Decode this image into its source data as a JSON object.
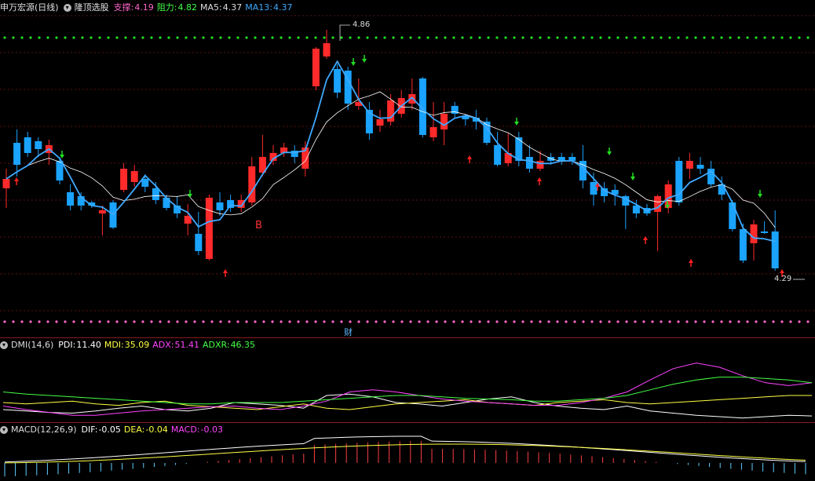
{
  "header": {
    "stock_name": "申万宏源(日线)",
    "indicator_name": "隆顶选股",
    "support_label": "支撑:",
    "support_value": "4.19",
    "resist_label": "阻力:",
    "resist_value": "4.82",
    "ma5_label": "MA5:",
    "ma5_value": "4.37",
    "ma13_label": "MA13:",
    "ma13_value": "4.37"
  },
  "main_chart": {
    "high_label": "4.86",
    "low_label": "4.29",
    "buy_marker": "B",
    "finance_label": "财",
    "colors": {
      "up": "#ff2a2a",
      "down": "#1aa3ff",
      "ma5": "#3fa9ff",
      "ma13": "#ffffff",
      "resist_dots": "#22dd22",
      "support_dots": "#ff66cc",
      "grid": "#5a1010"
    }
  },
  "dmi": {
    "title": "DMI(14,6)",
    "pdi_label": "PDI:",
    "pdi_value": "11.40",
    "mdi_label": "MDI:",
    "mdi_value": "35.09",
    "adx_label": "ADX:",
    "adx_value": "51.41",
    "adxr_label": "ADXR:",
    "adxr_value": "46.35",
    "colors": {
      "pdi": "#ffffff",
      "mdi": "#ffff44",
      "adx": "#ff44ff",
      "adxr": "#44ff44"
    }
  },
  "macd": {
    "title": "MACD(12,26,9)",
    "dif_label": "DIF:",
    "dif_value": "-0.05",
    "dea_label": "DEA:",
    "dea_value": "-0.04",
    "macd_label": "MACD:",
    "macd_value": "-0.03",
    "colors": {
      "dif": "#ffffff",
      "dea": "#ffff44",
      "macd": "#ff44ff"
    }
  }
}
